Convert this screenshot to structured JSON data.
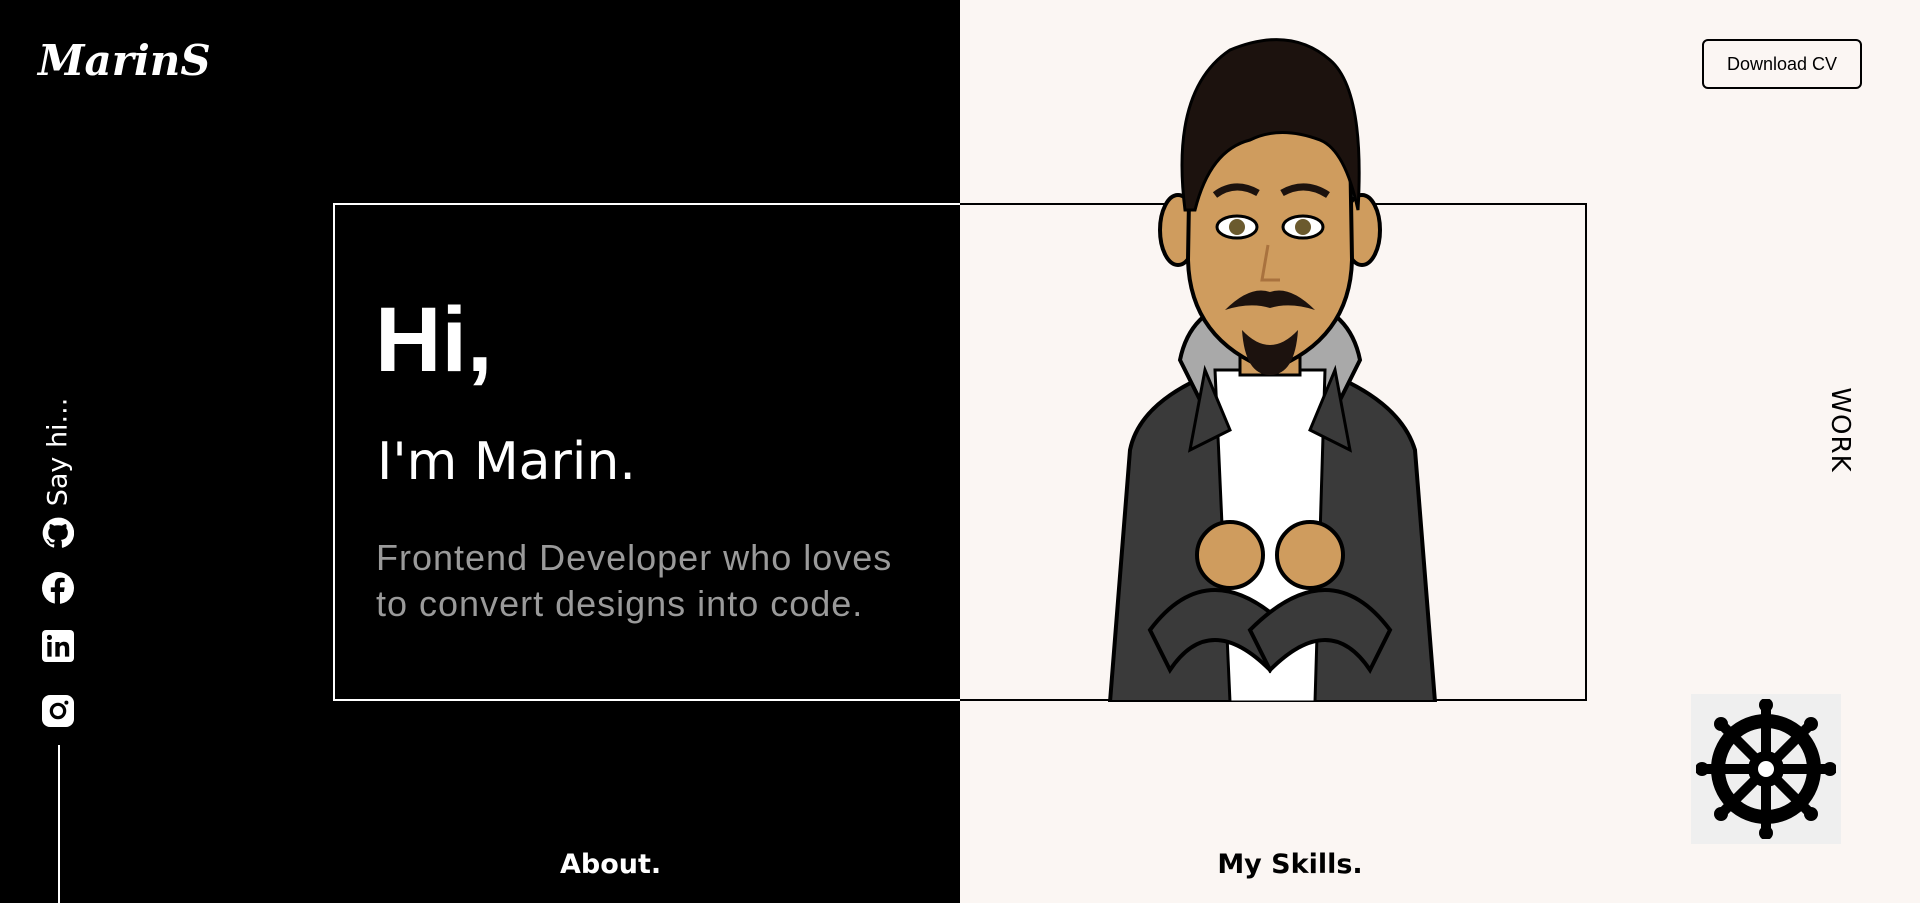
{
  "header": {
    "logo_text": "MarinS",
    "download_cv_label": "Download CV"
  },
  "hero": {
    "greeting": "Hi,",
    "name": "I'm Marin.",
    "tagline": "Frontend Developer who loves to convert designs into code."
  },
  "social": {
    "say_hi_label": "Say hi...",
    "links": [
      {
        "icon": "github-icon"
      },
      {
        "icon": "facebook-icon"
      },
      {
        "icon": "linkedin-icon"
      },
      {
        "icon": "instagram-icon"
      }
    ]
  },
  "nav": {
    "work_label": "WORK",
    "about_label": "About.",
    "skills_label": "My Skills."
  },
  "colors": {
    "dark_bg": "#000000",
    "light_bg": "#fbf6f3",
    "muted_text": "#9a9a9a"
  }
}
